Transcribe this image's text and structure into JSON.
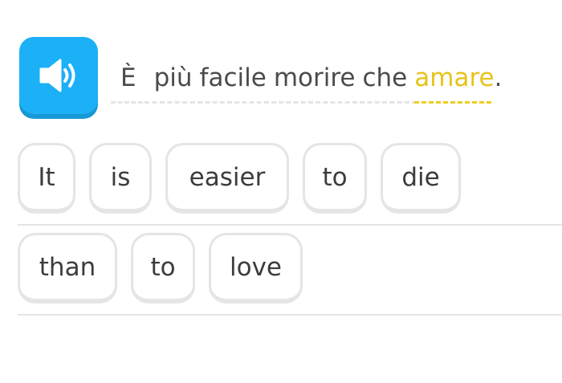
{
  "speaker": {
    "icon": "speaker-icon",
    "color": "#1cb0f6"
  },
  "prompt": {
    "words": [
      "È",
      "più",
      "facile",
      "morire",
      "che",
      "amare"
    ],
    "punctuation": ".",
    "highlight_color": "#e8c31b"
  },
  "answer": {
    "row1": [
      "It",
      "is",
      "easier",
      "to",
      "die"
    ],
    "row2": [
      "than",
      "to",
      "love"
    ]
  }
}
